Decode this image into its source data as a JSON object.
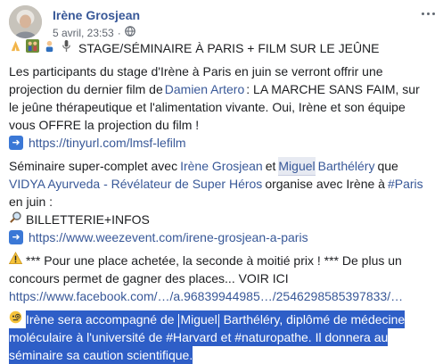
{
  "header": {
    "author": "Irène Grosjean",
    "date": "5 avril, 23:53",
    "separator": "·"
  },
  "post": {
    "title": "STAGE/SÉMINAIRE À PARIS + FILM SUR LE JEÛNE",
    "p1": {
      "l1": "Les participants du stage d'Irène à Paris en juin se verront offrir une",
      "l2a": "projection du dernier film de ",
      "l2link": "Damien Artero",
      "l2b": " : LA MARCHE SANS FAIM, sur",
      "l3": "le jeûne thérapeutique et l'alimentation vivante. Oui, Irène et son équipe",
      "l4": "vous OFFRE la projection du film !",
      "l5link": "https://tinyurl.com/lmsf-lefilm"
    },
    "p2": {
      "l1a": "Séminaire super-complet avec ",
      "l1link1": "Irène Grosjean",
      "l1b": " et ",
      "l1link2a": "Miguel",
      "l1link2b": " Barthéléry",
      "l1c": " que",
      "l2link": "VIDYA Ayurveda - Révélateur de Super Héros",
      "l2b": " organise avec Irène à ",
      "l2link2": "#Paris",
      "l3": "en juin :",
      "l4": "BILLETTERIE+INFOS",
      "l5link": "https://www.weezevent.com/irene-grosjean-a-paris"
    },
    "p3": {
      "l1": "*** Pour une place achetée, la seconde à moitié prix ! *** De plus un",
      "l2": "concours permet de gagner des places... VOIR ICI",
      "l3link": "https://www.facebook.com/…/a.96839944985…/2546298585397833/…"
    },
    "p4": {
      "l1a": "Irène sera accompagné de ",
      "l1b": "Miguel",
      "l1c": " Barthéléry, diplômé de médecine",
      "l2a": "moléculaire à l'université de ",
      "l2link": "#Harvard",
      "l2b": " et ",
      "l2link2": "#naturopathe",
      "l2c": ". Il donnera au",
      "l3": "séminaire sa caution scientifique."
    }
  },
  "icons": [
    "avatar-photo",
    "globe-icon",
    "more-options-icon",
    "pray-hands-emoji",
    "family-emoji",
    "person-emoji",
    "microphone-emoji",
    "arrow-right-emoji",
    "magnifier-emoji",
    "warning-emoji",
    "monocle-face-emoji"
  ],
  "colors": {
    "link": "#385898",
    "selection": "#2e5ec7",
    "meta": "#616770",
    "text": "#1c1e21"
  }
}
